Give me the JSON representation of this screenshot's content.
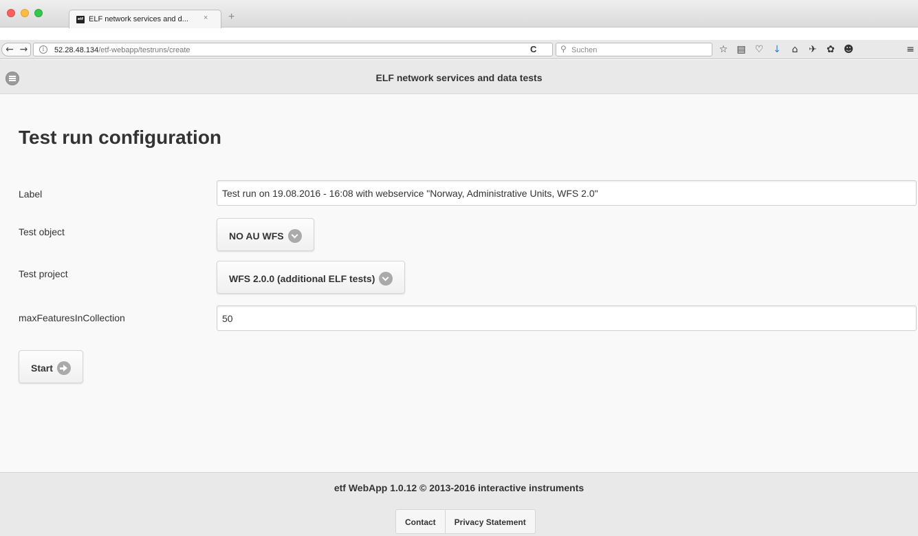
{
  "browser": {
    "tab_title": "ELF network services and d...",
    "tab_close": "×",
    "new_tab": "+",
    "favicon_text": "etf",
    "url_host": "52.28.48.134",
    "url_path": "/etf-webapp/testruns/create",
    "search_placeholder": "Suchen"
  },
  "header": {
    "title": "ELF network services and data tests"
  },
  "page": {
    "title": "Test run configuration",
    "fields": {
      "label": {
        "label": "Label",
        "value": "Test run on 19.08.2016 - 16:08 with webservice \"Norway, Administrative Units, WFS 2.0\""
      },
      "test_object": {
        "label": "Test object",
        "value": "NO AU WFS"
      },
      "test_project": {
        "label": "Test project",
        "value": "WFS 2.0.0 (additional ELF tests)"
      },
      "max_features": {
        "label": "maxFeaturesInCollection",
        "value": "50"
      }
    },
    "start_label": "Start"
  },
  "footer": {
    "text": "etf WebApp 1.0.12 © 2013-2016 interactive instruments",
    "links": [
      "Contact",
      "Privacy Statement"
    ]
  }
}
